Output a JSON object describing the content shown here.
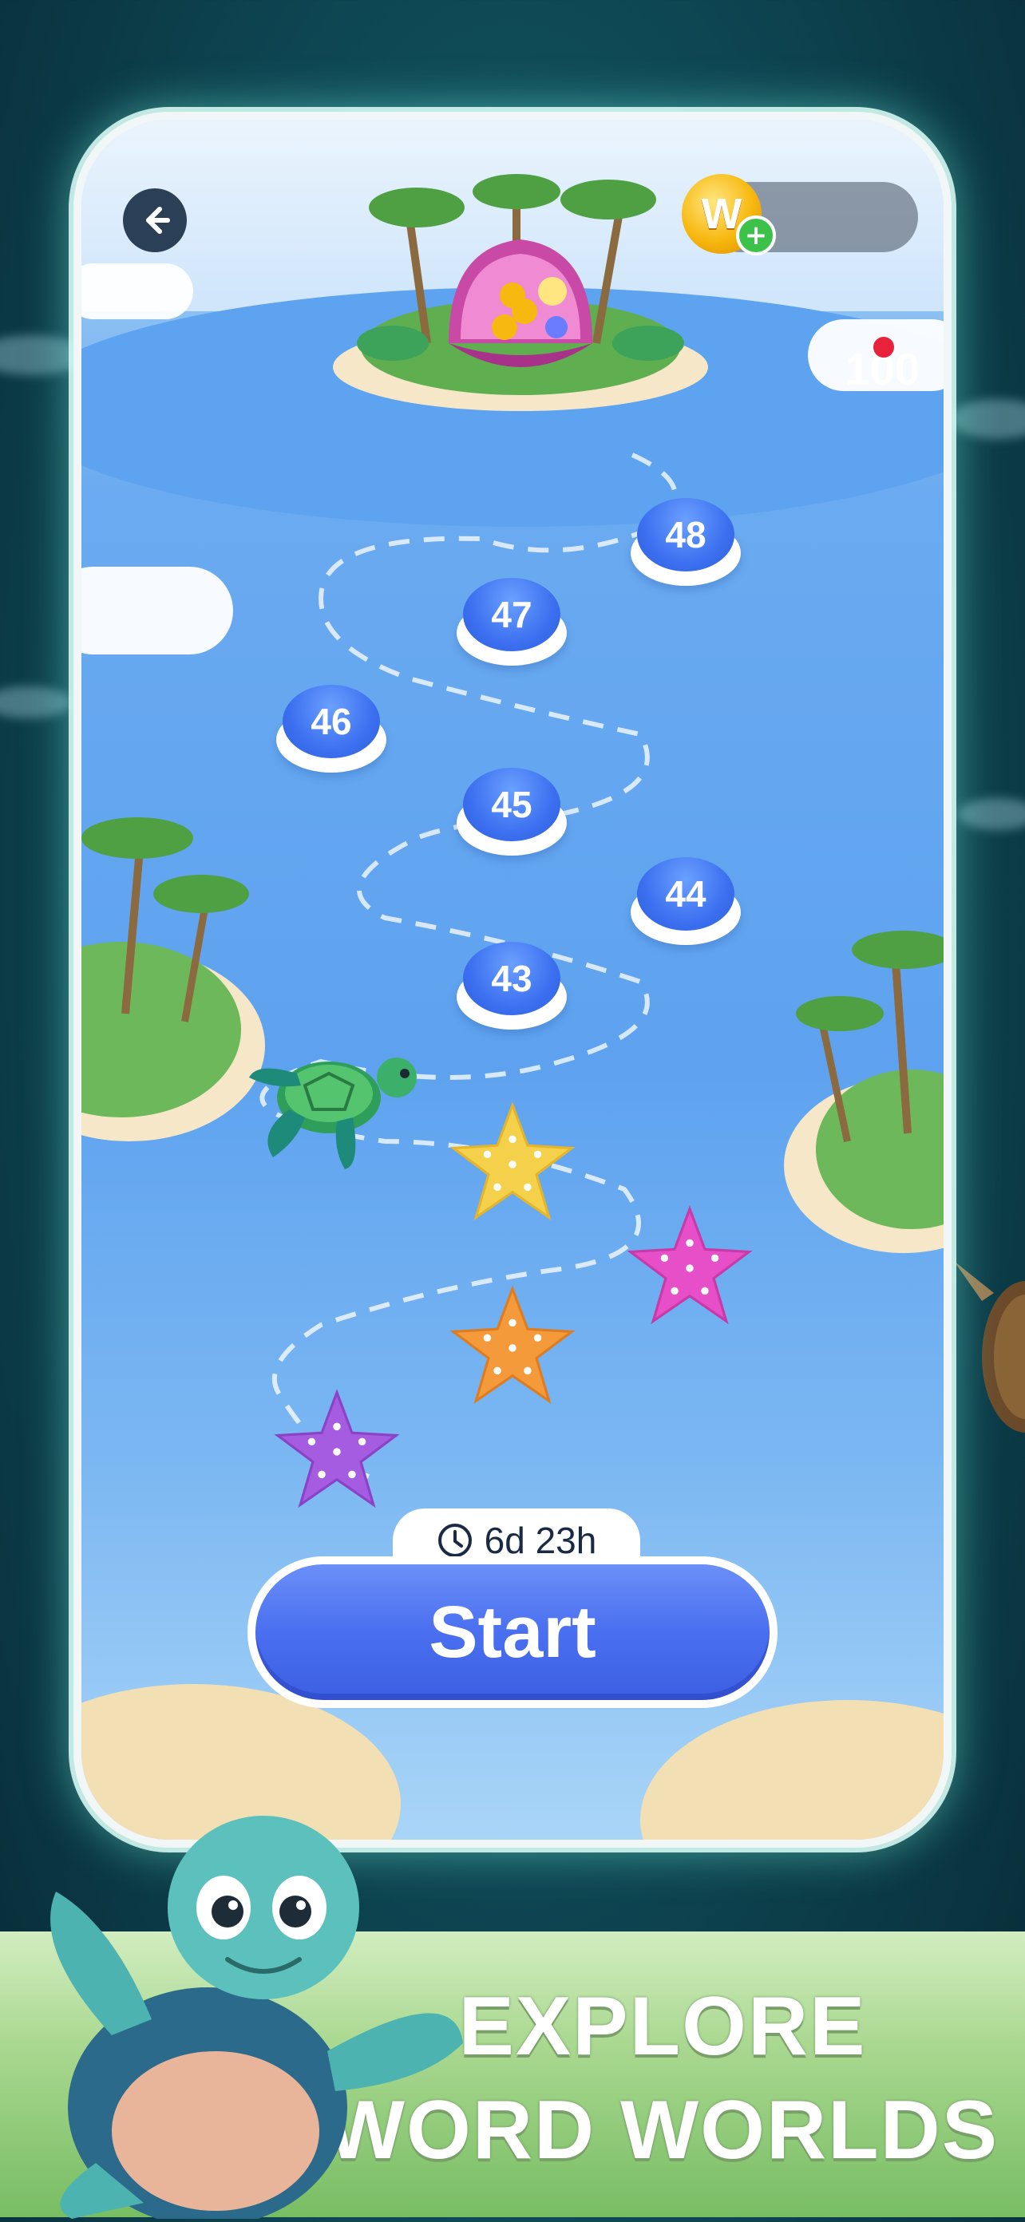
{
  "header": {
    "back_icon": "arrow-left-icon",
    "coin_symbol": "W",
    "coin_plus": "+",
    "reward_amount": "100"
  },
  "map": {
    "levels": [
      "48",
      "47",
      "46",
      "45",
      "44",
      "43"
    ],
    "stars": [
      {
        "color": "#f5d04a"
      },
      {
        "color": "#e64fc8"
      },
      {
        "color": "#f59a3a"
      },
      {
        "color": "#a65ce0"
      }
    ]
  },
  "event": {
    "timer": "6d 23h",
    "start_label": "Start"
  },
  "banner": {
    "line1": "EXPLORE",
    "line2": "WORD WORLDS"
  },
  "colors": {
    "accent": "#4a6ff0",
    "coin": "#f7b80f",
    "notification": "#e8223a"
  }
}
